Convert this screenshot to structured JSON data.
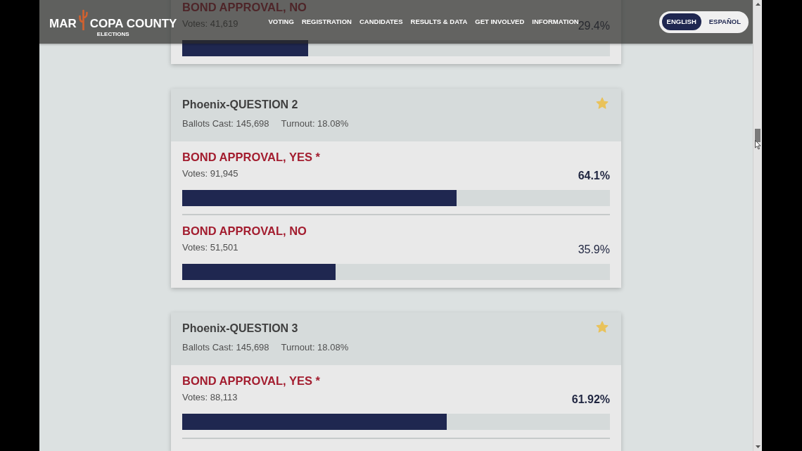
{
  "header": {
    "logo": {
      "text_before_cactus": "MAR",
      "text_after_cactus": "COPA COUNTY",
      "subtitle": "ELECTIONS"
    },
    "nav": [
      "VOTING",
      "REGISTRATION",
      "CANDIDATES",
      "RESULTS & DATA",
      "GET INVOLVED",
      "INFORMATION"
    ],
    "languages": [
      {
        "label": "ENGLISH",
        "selected": true
      },
      {
        "label": "ESPAÑOL",
        "selected": false
      }
    ]
  },
  "contests": [
    {
      "choices": [
        {
          "name": "BOND APPROVAL, NO",
          "votes": "Votes: 41,619",
          "percent": "29.4%",
          "winner": false,
          "level": 0.294
        }
      ]
    },
    {
      "title": "Phoenix-QUESTION 2",
      "ballots_cast": "Ballots Cast: 145,698",
      "turnout": "Turnout: 18.08%",
      "starred": true,
      "choices": [
        {
          "name": "BOND APPROVAL, YES *",
          "votes": "Votes: 91,945",
          "percent": "64.1%",
          "winner": true,
          "level": 0.641
        },
        {
          "name": "BOND APPROVAL, NO",
          "votes": "Votes: 51,501",
          "percent": "35.9%",
          "winner": false,
          "level": 0.359
        }
      ]
    },
    {
      "title": "Phoenix-QUESTION 3",
      "ballots_cast": "Ballots Cast: 145,698",
      "turnout": "Turnout: 18.08%",
      "starred": true,
      "continues": true,
      "choices": [
        {
          "name": "BOND APPROVAL, YES *",
          "votes": "Votes: 88,113",
          "percent": "61.92%",
          "winner": true,
          "level": 0.6192
        }
      ]
    }
  ]
}
